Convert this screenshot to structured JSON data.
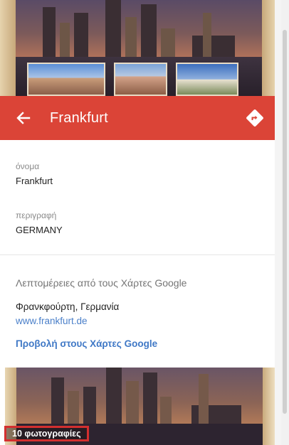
{
  "header": {
    "title": "Frankfurt",
    "back_icon": "arrow-left-icon",
    "directions_icon": "directions-icon",
    "color": "#db4437"
  },
  "details": {
    "name_label": "όνομα",
    "name_value": "Frankfurt",
    "description_label": "περιγραφή",
    "description_value": "GERMANY"
  },
  "maps_section": {
    "title": "Λεπτομέρειες από τους Χάρτες Google",
    "place": "Φρανκφούρτη, Γερμανία",
    "website": "www.frankfurt.de",
    "view_link": "Προβολή στους Χάρτες Google",
    "link_color": "#3f78c6"
  },
  "photos": {
    "count_label": "10 φωτογραφίες"
  }
}
